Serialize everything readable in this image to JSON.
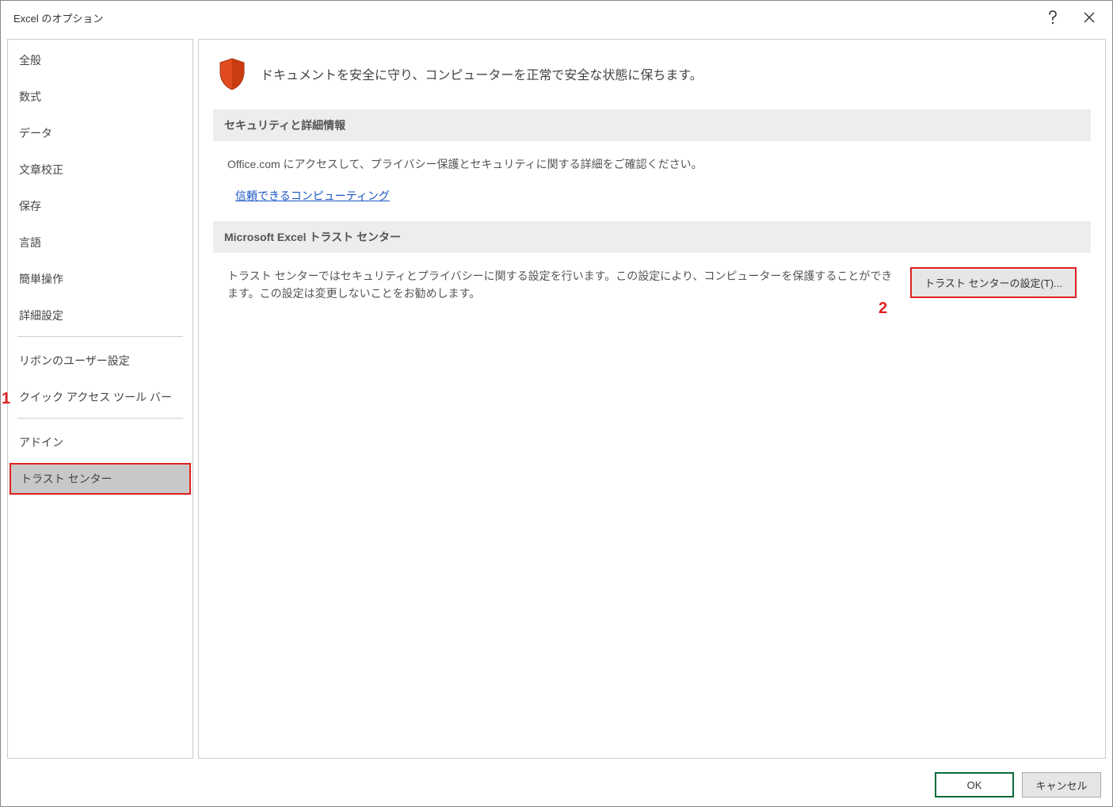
{
  "title": "Excel のオプション",
  "titlebar": {
    "help_icon": "help-icon",
    "close_icon": "close-icon"
  },
  "annotations": {
    "one": "1",
    "two": "2"
  },
  "sidebar": {
    "items": [
      {
        "label": "全般"
      },
      {
        "label": "数式"
      },
      {
        "label": "データ"
      },
      {
        "label": "文章校正"
      },
      {
        "label": "保存"
      },
      {
        "label": "言語"
      },
      {
        "label": "簡単操作"
      },
      {
        "label": "詳細設定"
      }
    ],
    "items2": [
      {
        "label": "リボンのユーザー設定"
      },
      {
        "label": "クイック アクセス ツール バー"
      }
    ],
    "items3": [
      {
        "label": "アドイン"
      },
      {
        "label": "トラスト センター",
        "selected": true
      }
    ]
  },
  "content": {
    "hero_text": "ドキュメントを安全に守り、コンピューターを正常で安全な状態に保ちます。",
    "section1": {
      "header": "セキュリティと詳細情報",
      "body": "Office.com にアクセスして、プライバシー保護とセキュリティに関する詳細をご確認ください。",
      "link": "信頼できるコンピューティング"
    },
    "section2": {
      "header": "Microsoft Excel トラスト センター",
      "body": "トラスト センターではセキュリティとプライバシーに関する設定を行います。この設定により、コンピューターを保護することができます。この設定は変更しないことをお勧めします。",
      "button": "トラスト センターの設定(T)..."
    }
  },
  "footer": {
    "ok": "OK",
    "cancel": "キャンセル"
  }
}
